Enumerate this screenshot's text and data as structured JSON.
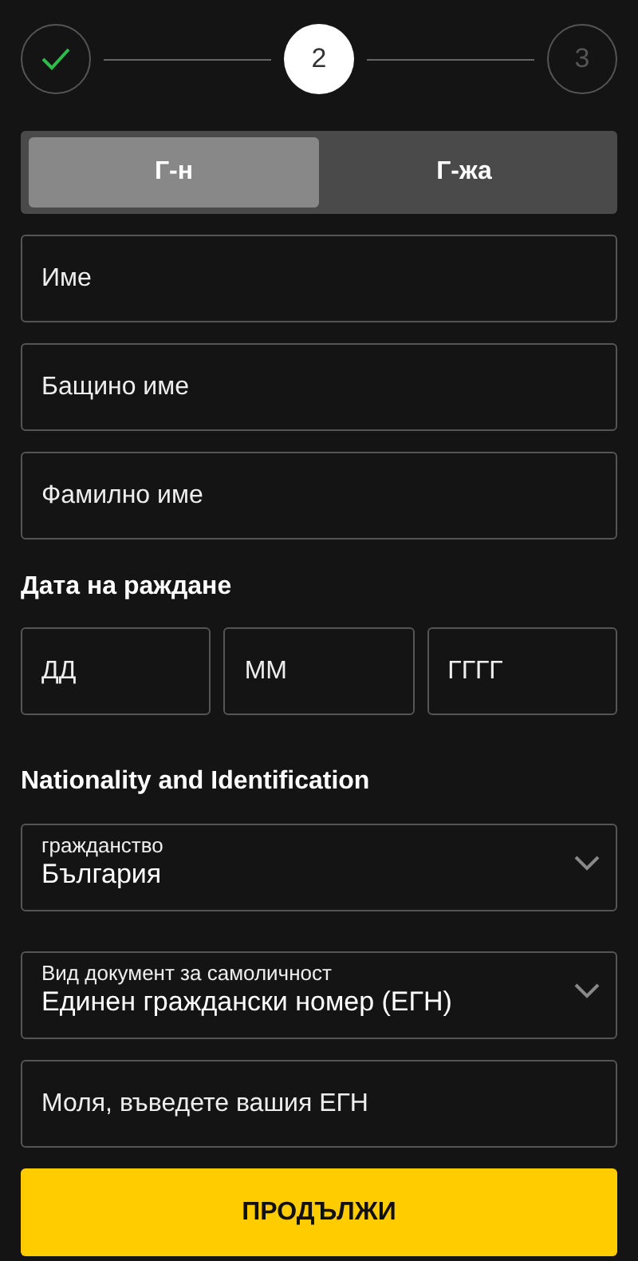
{
  "steps": [
    {
      "completed": true,
      "selected": false
    },
    {
      "completed": false,
      "selected": true,
      "label": "2"
    },
    {
      "completed": false,
      "selected": false,
      "label": "3"
    }
  ],
  "gender": [
    {
      "label": "Г-н",
      "selected": true
    },
    {
      "label": "Г-жа",
      "selected": false
    }
  ],
  "name_fields": [
    {
      "placeholder": "Име"
    },
    {
      "placeholder": "Бащино име"
    },
    {
      "placeholder": "Фамилно име"
    }
  ],
  "birth_date": {
    "heading": "Дата на раждане",
    "fields": [
      {
        "placeholder": "ДД"
      },
      {
        "placeholder": "ММ"
      },
      {
        "placeholder": "ГГГГ"
      }
    ]
  },
  "identification": {
    "heading": "Nationality and Identification",
    "selects": [
      {
        "label": "гражданство",
        "value": "България"
      },
      {
        "label": "Вид документ за самоличност",
        "value": "Единен граждански номер (ЕГН)"
      }
    ],
    "id_field": {
      "placeholder": "Моля, въведете вашия ЕГН"
    }
  },
  "continue_button": "ПРОДЪЛЖИ"
}
